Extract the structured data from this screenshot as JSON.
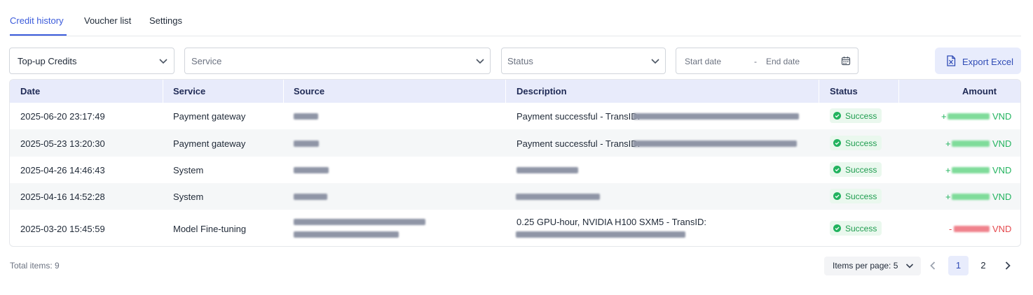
{
  "tabs": [
    {
      "label": "Credit history",
      "active": true
    },
    {
      "label": "Voucher list",
      "active": false
    },
    {
      "label": "Settings",
      "active": false
    }
  ],
  "filters": {
    "type": {
      "value": "Top-up Credits"
    },
    "service": {
      "placeholder": "Service"
    },
    "status": {
      "placeholder": "Status"
    },
    "date": {
      "start_placeholder": "Start date",
      "separator": "-",
      "end_placeholder": "End date"
    }
  },
  "export_button": {
    "label": "Export Excel",
    "icon": "excel-icon"
  },
  "table": {
    "columns": [
      "Date",
      "Service",
      "Source",
      "Description",
      "Status",
      "Amount"
    ],
    "rows": [
      {
        "date": "2025-06-20 23:17:49",
        "service": "Payment gateway",
        "description": "Payment successful - TransID:",
        "status": "Success",
        "sign": "+",
        "currency": "VND",
        "type": "credit"
      },
      {
        "date": "2025-05-23 13:20:30",
        "service": "Payment gateway",
        "description": "Payment successful - TransID:",
        "status": "Success",
        "sign": "+",
        "currency": "VND",
        "type": "credit"
      },
      {
        "date": "2025-04-26 14:46:43",
        "service": "System",
        "description": "",
        "status": "Success",
        "sign": "+",
        "currency": "VND",
        "type": "credit"
      },
      {
        "date": "2025-04-16 14:52:28",
        "service": "System",
        "description": "",
        "status": "Success",
        "sign": "+",
        "currency": "VND",
        "type": "credit"
      },
      {
        "date": "2025-03-20 15:45:59",
        "service": "Model Fine-tuning",
        "description": "0.25 GPU-hour, NVIDIA H100 SXM5 - TransID:",
        "status": "Success",
        "sign": "-",
        "currency": "VND",
        "type": "debit"
      }
    ]
  },
  "footer": {
    "total_items": "Total items: 9",
    "items_per_page": "Items per page: 5",
    "pages": [
      "1",
      "2"
    ],
    "current_page": "1"
  },
  "colors": {
    "accent": "#3b5bdb",
    "success": "#1f9d4f",
    "credit": "#22b35e",
    "debit": "#e5484d",
    "header_bg": "#e8ebfb"
  }
}
